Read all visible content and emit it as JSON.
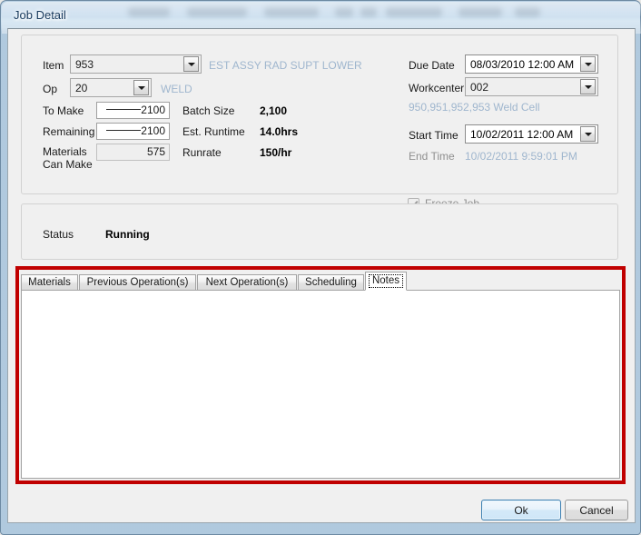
{
  "window": {
    "title": "Job Detail"
  },
  "job": {
    "item_label": "Item",
    "item_value": "953",
    "item_description": "EST ASSY RAD SUPT LOWER",
    "op_label": "Op",
    "op_value": "20",
    "op_description": "WELD",
    "to_make_label": "To Make",
    "to_make_value": "2100",
    "remaining_label": "Remaining",
    "remaining_value": "2100",
    "materials_can_make_label_line1": "Materials",
    "materials_can_make_label_line2": "Can Make",
    "materials_can_make_value": "575",
    "batch_size_label": "Batch Size",
    "batch_size_value": "2,100",
    "est_runtime_label": "Est. Runtime",
    "est_runtime_value": "14.0hrs",
    "runrate_label": "Runrate",
    "runrate_value": "150/hr",
    "due_date_label": "Due Date",
    "due_date_value": "08/03/2010 12:00 AM",
    "workcenter_label": "Workcenter",
    "workcenter_value": "002",
    "workcenter_description": "950,951,952,953 Weld Cell",
    "start_time_label": "Start Time",
    "start_time_value": "10/02/2011 12:00 AM",
    "end_time_label": "End Time",
    "end_time_value": "10/02/2011 9:59:01 PM",
    "freeze_job_label": "Freeze Job"
  },
  "status": {
    "label": "Status",
    "value": "Running"
  },
  "tabs": [
    {
      "label": "Materials",
      "selected": false
    },
    {
      "label": "Previous Operation(s)",
      "selected": false
    },
    {
      "label": "Next Operation(s)",
      "selected": false
    },
    {
      "label": "Scheduling",
      "selected": false
    },
    {
      "label": "Notes",
      "selected": true
    }
  ],
  "notes": {
    "content": ""
  },
  "buttons": {
    "ok": "Ok",
    "cancel": "Cancel"
  },
  "icons": {
    "dropdown": "chevron-down-icon",
    "checkmark": "check-icon"
  },
  "colors": {
    "highlight_border": "#c00000",
    "disabled_text": "#9fb6ce",
    "default_button_border": "#3c7fb1",
    "glass_title": "#16385c"
  }
}
